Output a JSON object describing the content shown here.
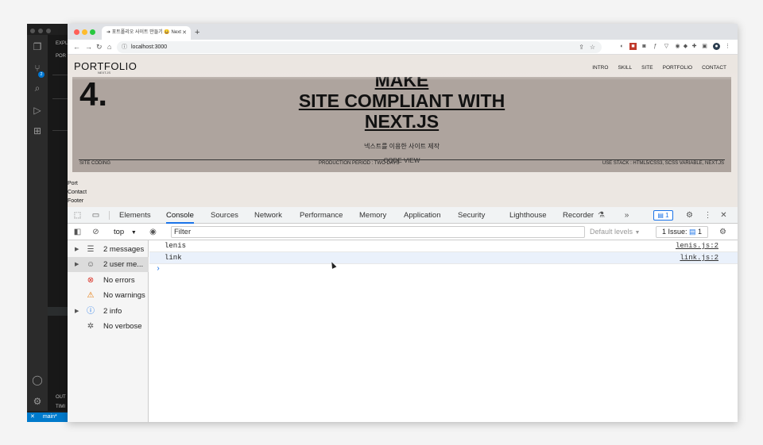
{
  "vscode": {
    "branch": "main*",
    "source_control_badge": "2",
    "sidebar_header": "EXPL",
    "sidebar_items": [
      "POR",
      "OUT",
      "TIMI"
    ]
  },
  "browser": {
    "tab_title": "포트폴리오 사이트 만들기 😀  Next",
    "url": "localhost:3000"
  },
  "site": {
    "logo": "PORTFOLIO",
    "logo_sub": "NEXT.JS",
    "menu": [
      "INTRO",
      "SKILL",
      "SITE",
      "PORTFOLIO",
      "CONTACT"
    ],
    "number": "4.",
    "title_lines": [
      "MAKE",
      "SITE COMPLIANT WITH",
      "NEXT.JS"
    ],
    "subtitle": "넥스트를 이용한 사이트 제작",
    "footer_left": "SITE CODING",
    "footer_mid": "PRODUCTION PERIOD : TWO DAYS",
    "code_view": "CODE VIEW",
    "footer_right": "USE STACK : HTML5/CSS3, SCSS VARIABLE, NEXT.JS",
    "links": [
      "Port",
      "Contact",
      "Footer"
    ]
  },
  "devtools": {
    "tabs": [
      "Elements",
      "Console",
      "Sources",
      "Network",
      "Performance",
      "Memory",
      "Application",
      "Security",
      "Lighthouse",
      "Recorder"
    ],
    "active_tab": "Console",
    "messages_badge": "1",
    "context": "top",
    "filter_placeholder": "Filter",
    "levels": "Default levels",
    "issues_label": "1 Issue:",
    "issues_count": "1",
    "sidebar": [
      {
        "label": "2 messages",
        "icon": "list-icon"
      },
      {
        "label": "2 user me...",
        "icon": "user-icon"
      },
      {
        "label": "No errors",
        "icon": "error-icon"
      },
      {
        "label": "No warnings",
        "icon": "warning-icon"
      },
      {
        "label": "2 info",
        "icon": "info-icon"
      },
      {
        "label": "No verbose",
        "icon": "bug-icon"
      }
    ],
    "console_messages": [
      {
        "text": "lenis",
        "source": "lenis.js:2"
      },
      {
        "text": "link",
        "source": "link.js:2"
      }
    ]
  }
}
